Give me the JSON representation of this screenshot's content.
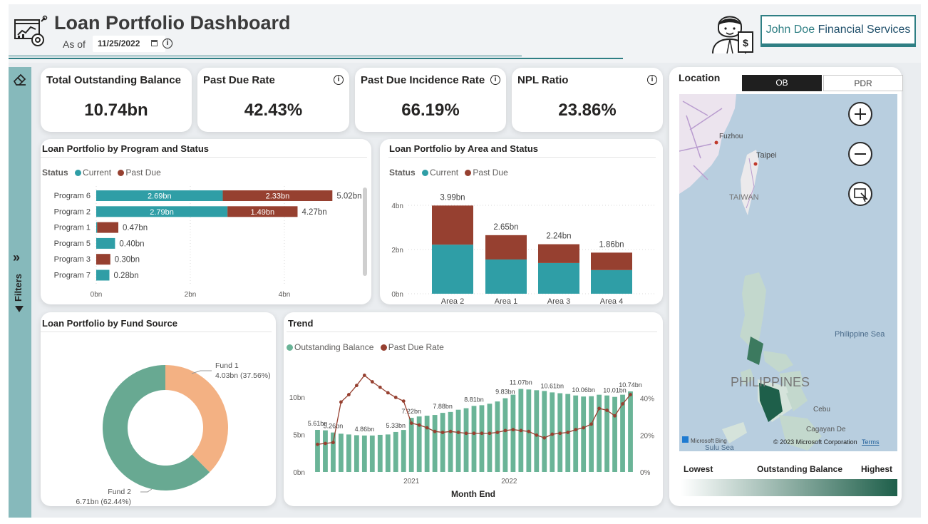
{
  "header": {
    "title": "Loan Portfolio Dashboard",
    "as_of_label": "As of",
    "as_of_date": "11/25/2022",
    "company_first": "John Doe",
    "company_second": "Financial Services"
  },
  "sidebar": {
    "filters_label": "Filters"
  },
  "kpis": [
    {
      "title": "Total Outstanding Balance",
      "value": "10.74bn"
    },
    {
      "title": "Past Due Rate",
      "value": "42.43%"
    },
    {
      "title": "Past Due Incidence Rate",
      "value": "66.19%"
    },
    {
      "title": "NPL Ratio",
      "value": "23.86%"
    }
  ],
  "colors": {
    "current": "#2f9ea6",
    "past_due": "#964030",
    "fund1": "#f3b183",
    "fund2": "#68a992",
    "trend_bar": "#6ab497",
    "trend_line": "#964030",
    "map_accent": "#1e5f4a"
  },
  "program_chart": {
    "title": "Loan Portfolio by Program and Status",
    "legend_label": "Status",
    "legend_current": "Current",
    "legend_past_due": "Past Due"
  },
  "area_chart": {
    "title": "Loan Portfolio by Area and Status",
    "legend_label": "Status",
    "legend_current": "Current",
    "legend_past_due": "Past Due"
  },
  "fund_chart": {
    "title": "Loan Portfolio by Fund Source"
  },
  "trend_chart": {
    "title": "Trend",
    "legend_bar": "Outstanding Balance",
    "legend_line": "Past Due Rate"
  },
  "map": {
    "title": "Location",
    "toggle_ob": "OB",
    "toggle_pdr": "PDR",
    "labels": {
      "fuzhou": "Fuzhou",
      "taipei": "Taipei",
      "taiwan": "TAIWAN",
      "philippine_sea": "Philippine Sea",
      "philippines": "PHILIPPINES",
      "cebu": "Cebu",
      "cagayan": "Cagayan De",
      "sulu": "Sulu Sea"
    },
    "attribution_bing": "Microsoft Bing",
    "attribution_copyright": "© 2023 Microsoft Corporation",
    "attribution_terms": "Terms",
    "scale_lowest": "Lowest",
    "scale_title": "Outstanding Balance",
    "scale_highest": "Highest"
  },
  "chart_data": [
    {
      "type": "bar",
      "orientation": "horizontal",
      "stacked": true,
      "title": "Loan Portfolio by Program and Status",
      "categories": [
        "Program 6",
        "Program 2",
        "Program 1",
        "Program 5",
        "Program 3",
        "Program 7"
      ],
      "series": [
        {
          "name": "Current",
          "values": [
            2.69,
            2.79,
            0.02,
            0.4,
            0.0,
            0.28
          ],
          "labels": [
            "2.69bn",
            "2.79bn",
            "",
            "",
            "",
            ""
          ]
        },
        {
          "name": "Past Due",
          "values": [
            2.33,
            1.49,
            0.45,
            0.0,
            0.3,
            0.0
          ],
          "labels": [
            "2.33bn",
            "1.49bn",
            "",
            "",
            "",
            ""
          ]
        }
      ],
      "totals": [
        "5.02bn",
        "4.27bn",
        "0.47bn",
        "0.40bn",
        "0.30bn",
        "0.28bn"
      ],
      "x_ticks": [
        "0bn",
        "2bn",
        "4bn"
      ],
      "xlim": [
        0,
        5.5
      ],
      "legend": "top-left"
    },
    {
      "type": "bar",
      "stacked": true,
      "title": "Loan Portfolio by Area and Status",
      "categories": [
        "Area 2",
        "Area 1",
        "Area 3",
        "Area 4"
      ],
      "series": [
        {
          "name": "Current",
          "values": [
            2.22,
            1.55,
            1.39,
            1.07
          ]
        },
        {
          "name": "Past Due",
          "values": [
            1.77,
            1.1,
            0.85,
            0.79
          ]
        }
      ],
      "totals": [
        "3.99bn",
        "2.65bn",
        "2.24bn",
        "1.86bn"
      ],
      "y_ticks": [
        "0bn",
        "2bn",
        "4bn"
      ],
      "ylim": [
        0,
        4.2
      ],
      "legend": "top-left"
    },
    {
      "type": "pie",
      "donut": true,
      "title": "Loan Portfolio by Fund Source",
      "slices": [
        {
          "name": "Fund 1",
          "value": 4.03,
          "label": "4.03bn (37.56%)"
        },
        {
          "name": "Fund 2",
          "value": 6.71,
          "label": "6.71bn (62.44%)"
        }
      ]
    },
    {
      "type": "bar+line",
      "title": "Trend",
      "xlabel": "Month End",
      "x_ticks": [
        "2021",
        "2022"
      ],
      "y_ticks_left": [
        "0bn",
        "5bn",
        "10bn"
      ],
      "y_ticks_right": [
        "0%",
        "20%",
        "40%"
      ],
      "ylim_left": [
        0,
        13.5
      ],
      "ylim_right": [
        0,
        0.55
      ],
      "series": [
        {
          "name": "Outstanding Balance",
          "type": "bar",
          "values": [
            5.61,
            5.55,
            5.26,
            5.1,
            5.0,
            4.9,
            4.86,
            4.86,
            4.95,
            5.0,
            5.33,
            5.6,
            7.22,
            7.4,
            7.5,
            7.6,
            7.88,
            8.0,
            8.3,
            8.5,
            8.81,
            8.9,
            9.1,
            9.4,
            9.83,
            10.3,
            11.07,
            11.0,
            10.9,
            10.8,
            10.61,
            10.5,
            10.4,
            10.2,
            10.06,
            10.1,
            10.3,
            10.2,
            10.01,
            10.3,
            10.74
          ],
          "labels": [
            "5.61bn",
            "",
            "5.26bn",
            "",
            "",
            "",
            "4.86bn",
            "",
            "",
            "",
            "5.33bn",
            "",
            "7.22bn",
            "",
            "",
            "",
            "7.88bn",
            "",
            "",
            "",
            "8.81bn",
            "",
            "",
            "",
            "9.83bn",
            "",
            "11.07bn",
            "",
            "",
            "",
            "10.61bn",
            "",
            "",
            "",
            "10.06bn",
            "",
            "",
            "",
            "10.01bn",
            "",
            "10.74bn"
          ]
        },
        {
          "name": "Past Due Rate",
          "type": "line",
          "values": [
            0.15,
            0.155,
            0.16,
            0.38,
            0.42,
            0.47,
            0.525,
            0.49,
            0.46,
            0.43,
            0.405,
            0.385,
            0.265,
            0.255,
            0.24,
            0.22,
            0.215,
            0.22,
            0.215,
            0.21,
            0.21,
            0.21,
            0.21,
            0.215,
            0.225,
            0.23,
            0.225,
            0.22,
            0.2,
            0.185,
            0.205,
            0.21,
            0.215,
            0.23,
            0.24,
            0.26,
            0.345,
            0.335,
            0.305,
            0.37,
            0.42
          ]
        }
      ]
    }
  ]
}
